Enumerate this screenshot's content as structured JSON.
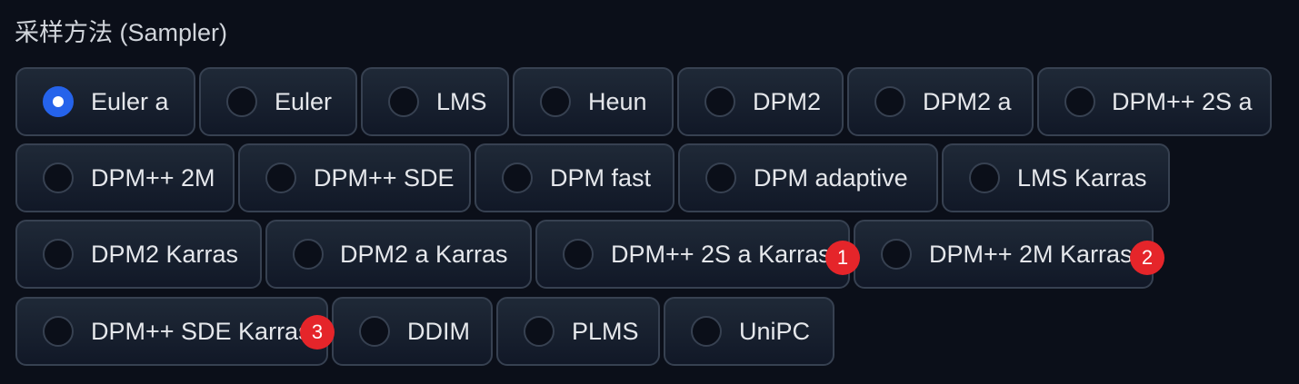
{
  "title": "采样方法 (Sampler)",
  "selected": "Euler a",
  "accent_color": "#2563eb",
  "badge_color": "#e5252a",
  "options": [
    {
      "label": "Euler a",
      "checked": true
    },
    {
      "label": "Euler",
      "checked": false
    },
    {
      "label": "LMS",
      "checked": false
    },
    {
      "label": "Heun",
      "checked": false
    },
    {
      "label": "DPM2",
      "checked": false
    },
    {
      "label": "DPM2 a",
      "checked": false
    },
    {
      "label": "DPM++ 2S a",
      "checked": false
    },
    {
      "label": "DPM++ 2M",
      "checked": false
    },
    {
      "label": "DPM++ SDE",
      "checked": false
    },
    {
      "label": "DPM fast",
      "checked": false
    },
    {
      "label": "DPM adaptive",
      "checked": false
    },
    {
      "label": "LMS Karras",
      "checked": false
    },
    {
      "label": "DPM2 Karras",
      "checked": false
    },
    {
      "label": "DPM2 a Karras",
      "checked": false
    },
    {
      "label": "DPM++ 2S a Karras",
      "checked": false
    },
    {
      "label": "DPM++ 2M Karras",
      "checked": false
    },
    {
      "label": "DPM++ SDE Karras",
      "checked": false
    },
    {
      "label": "DDIM",
      "checked": false
    },
    {
      "label": "PLMS",
      "checked": false
    },
    {
      "label": "UniPC",
      "checked": false
    }
  ],
  "badges": [
    "1",
    "2",
    "3"
  ]
}
